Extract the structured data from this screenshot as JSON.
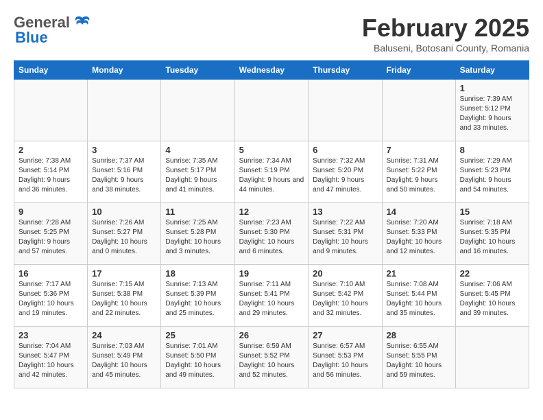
{
  "logo": {
    "general": "General",
    "blue": "Blue"
  },
  "title": {
    "month": "February 2025",
    "location": "Baluseni, Botosani County, Romania"
  },
  "weekdays": [
    "Sunday",
    "Monday",
    "Tuesday",
    "Wednesday",
    "Thursday",
    "Friday",
    "Saturday"
  ],
  "weeks": [
    [
      {
        "day": "",
        "info": ""
      },
      {
        "day": "",
        "info": ""
      },
      {
        "day": "",
        "info": ""
      },
      {
        "day": "",
        "info": ""
      },
      {
        "day": "",
        "info": ""
      },
      {
        "day": "",
        "info": ""
      },
      {
        "day": "1",
        "info": "Sunrise: 7:39 AM\nSunset: 5:12 PM\nDaylight: 9 hours and 33 minutes."
      }
    ],
    [
      {
        "day": "2",
        "info": "Sunrise: 7:38 AM\nSunset: 5:14 PM\nDaylight: 9 hours and 36 minutes."
      },
      {
        "day": "3",
        "info": "Sunrise: 7:37 AM\nSunset: 5:16 PM\nDaylight: 9 hours and 38 minutes."
      },
      {
        "day": "4",
        "info": "Sunrise: 7:35 AM\nSunset: 5:17 PM\nDaylight: 9 hours and 41 minutes."
      },
      {
        "day": "5",
        "info": "Sunrise: 7:34 AM\nSunset: 5:19 PM\nDaylight: 9 hours and 44 minutes."
      },
      {
        "day": "6",
        "info": "Sunrise: 7:32 AM\nSunset: 5:20 PM\nDaylight: 9 hours and 47 minutes."
      },
      {
        "day": "7",
        "info": "Sunrise: 7:31 AM\nSunset: 5:22 PM\nDaylight: 9 hours and 50 minutes."
      },
      {
        "day": "8",
        "info": "Sunrise: 7:29 AM\nSunset: 5:23 PM\nDaylight: 9 hours and 54 minutes."
      }
    ],
    [
      {
        "day": "9",
        "info": "Sunrise: 7:28 AM\nSunset: 5:25 PM\nDaylight: 9 hours and 57 minutes."
      },
      {
        "day": "10",
        "info": "Sunrise: 7:26 AM\nSunset: 5:27 PM\nDaylight: 10 hours and 0 minutes."
      },
      {
        "day": "11",
        "info": "Sunrise: 7:25 AM\nSunset: 5:28 PM\nDaylight: 10 hours and 3 minutes."
      },
      {
        "day": "12",
        "info": "Sunrise: 7:23 AM\nSunset: 5:30 PM\nDaylight: 10 hours and 6 minutes."
      },
      {
        "day": "13",
        "info": "Sunrise: 7:22 AM\nSunset: 5:31 PM\nDaylight: 10 hours and 9 minutes."
      },
      {
        "day": "14",
        "info": "Sunrise: 7:20 AM\nSunset: 5:33 PM\nDaylight: 10 hours and 12 minutes."
      },
      {
        "day": "15",
        "info": "Sunrise: 7:18 AM\nSunset: 5:35 PM\nDaylight: 10 hours and 16 minutes."
      }
    ],
    [
      {
        "day": "16",
        "info": "Sunrise: 7:17 AM\nSunset: 5:36 PM\nDaylight: 10 hours and 19 minutes."
      },
      {
        "day": "17",
        "info": "Sunrise: 7:15 AM\nSunset: 5:38 PM\nDaylight: 10 hours and 22 minutes."
      },
      {
        "day": "18",
        "info": "Sunrise: 7:13 AM\nSunset: 5:39 PM\nDaylight: 10 hours and 25 minutes."
      },
      {
        "day": "19",
        "info": "Sunrise: 7:11 AM\nSunset: 5:41 PM\nDaylight: 10 hours and 29 minutes."
      },
      {
        "day": "20",
        "info": "Sunrise: 7:10 AM\nSunset: 5:42 PM\nDaylight: 10 hours and 32 minutes."
      },
      {
        "day": "21",
        "info": "Sunrise: 7:08 AM\nSunset: 5:44 PM\nDaylight: 10 hours and 35 minutes."
      },
      {
        "day": "22",
        "info": "Sunrise: 7:06 AM\nSunset: 5:45 PM\nDaylight: 10 hours and 39 minutes."
      }
    ],
    [
      {
        "day": "23",
        "info": "Sunrise: 7:04 AM\nSunset: 5:47 PM\nDaylight: 10 hours and 42 minutes."
      },
      {
        "day": "24",
        "info": "Sunrise: 7:03 AM\nSunset: 5:49 PM\nDaylight: 10 hours and 45 minutes."
      },
      {
        "day": "25",
        "info": "Sunrise: 7:01 AM\nSunset: 5:50 PM\nDaylight: 10 hours and 49 minutes."
      },
      {
        "day": "26",
        "info": "Sunrise: 6:59 AM\nSunset: 5:52 PM\nDaylight: 10 hours and 52 minutes."
      },
      {
        "day": "27",
        "info": "Sunrise: 6:57 AM\nSunset: 5:53 PM\nDaylight: 10 hours and 56 minutes."
      },
      {
        "day": "28",
        "info": "Sunrise: 6:55 AM\nSunset: 5:55 PM\nDaylight: 10 hours and 59 minutes."
      },
      {
        "day": "",
        "info": ""
      }
    ]
  ]
}
